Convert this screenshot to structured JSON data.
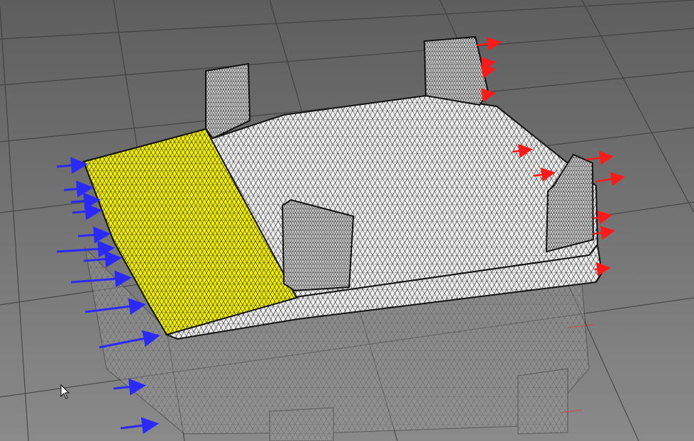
{
  "viewport": {
    "background_top": "#5e5e5e",
    "background_bottom": "#8a8a8a",
    "grid_color": "#3a3a3a"
  },
  "model": {
    "mesh_color": "#eeeeee",
    "mesh_line_color": "#1a1a1a",
    "selected_face_color": "#f2f000",
    "edge_color": "#111111",
    "reflection_opacity": 0.45
  },
  "loads": {
    "fixed_support_color": "#2a2aff",
    "force_color": "#ff1a1a"
  },
  "cursor": {
    "icon": "mouse-pointer-icon"
  }
}
